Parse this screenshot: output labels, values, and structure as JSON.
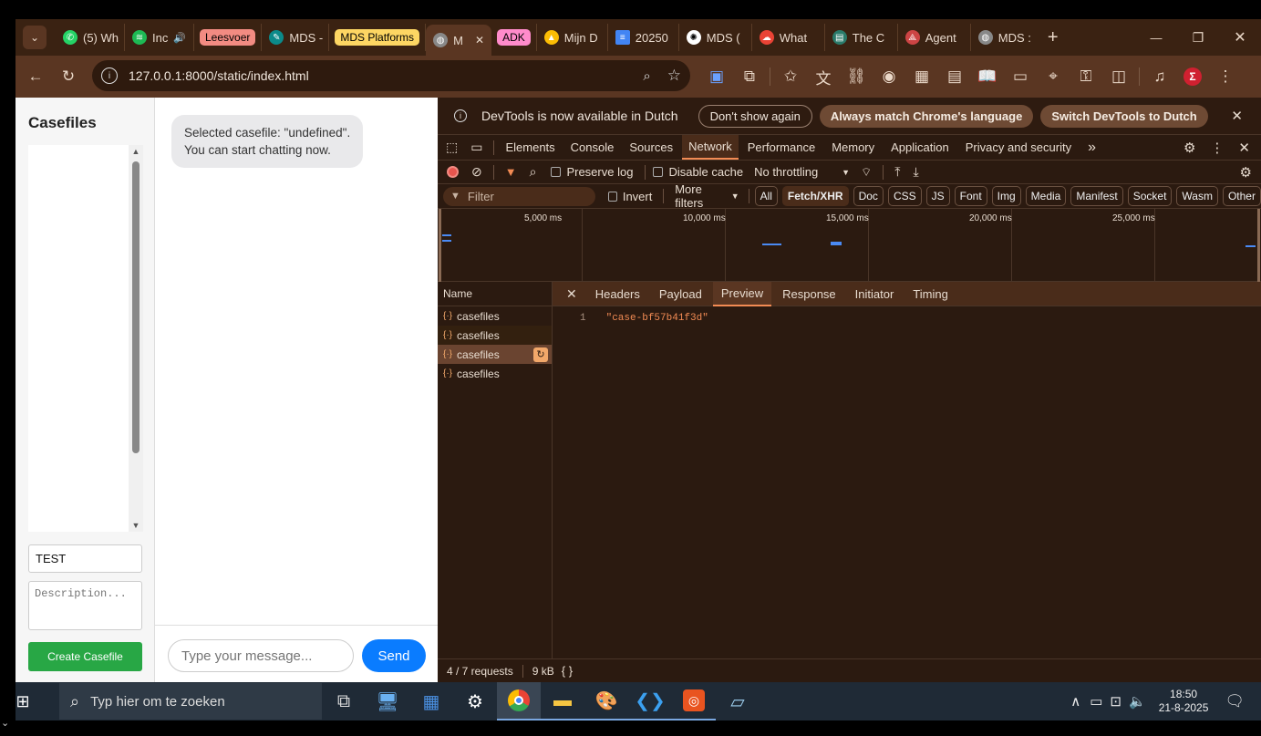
{
  "tabs": [
    {
      "title": "(5) Wh",
      "color": "#25d366",
      "icon": "whatsapp-icon"
    },
    {
      "title": "Inc",
      "color": "#1db954",
      "icon": "spotify-icon",
      "audio": "🔊"
    },
    {
      "group": "Leesvoer",
      "color": "#f28b82"
    },
    {
      "title": "MDS -",
      "color": "#1a73e8",
      "icon": "feather-icon"
    },
    {
      "group": "MDS Platforms",
      "color": "#fdd663"
    },
    {
      "title": "M",
      "active": true,
      "icon": "globe-icon",
      "close": "✕"
    },
    {
      "group": "ADK",
      "color": "#ff8bcb"
    },
    {
      "title": "Mijn D",
      "icon": "drive-icon"
    },
    {
      "title": "20250",
      "icon": "docs-icon"
    },
    {
      "title": "MDS (",
      "icon": "openai-icon"
    },
    {
      "title": "What",
      "icon": "cloud-icon"
    },
    {
      "title": "The C",
      "icon": "book-icon"
    },
    {
      "title": "Agent",
      "icon": "agent-icon"
    },
    {
      "title": "MDS :",
      "icon": "globe-icon"
    }
  ],
  "new_tab": "+",
  "window_controls": {
    "minimize": "—",
    "restore": "❐",
    "close": "✕"
  },
  "address": {
    "url": "127.0.0.1:8000/static/index.html"
  },
  "app": {
    "sidebar_title": "Casefiles",
    "name_value": "TEST",
    "description_placeholder": "Description...",
    "create_button": "Create Casefile",
    "bubble_line1": "Selected casefile: \"undefined\".",
    "bubble_line2": "You can start chatting now.",
    "message_placeholder": "Type your message...",
    "send_button": "Send"
  },
  "devtools": {
    "banner_text": "DevTools is now available in Dutch",
    "banner_btn1": "Don't show again",
    "banner_btn2": "Always match Chrome's language",
    "banner_btn3": "Switch DevTools to Dutch",
    "main_tabs": [
      "Elements",
      "Console",
      "Sources",
      "Network",
      "Performance",
      "Memory",
      "Application",
      "Privacy and security"
    ],
    "more_tabs": "»",
    "preserve_log": "Preserve log",
    "disable_cache": "Disable cache",
    "throttling": "No throttling",
    "filter_placeholder": "Filter",
    "invert": "Invert",
    "more_filters": "More filters",
    "type_filters": [
      "All",
      "Fetch/XHR",
      "Doc",
      "CSS",
      "JS",
      "Font",
      "Img",
      "Media",
      "Manifest",
      "Socket",
      "Wasm",
      "Other"
    ],
    "timeline_ticks": [
      "5,000 ms",
      "10,000 ms",
      "15,000 ms",
      "20,000 ms",
      "25,000 ms"
    ],
    "name_header": "Name",
    "requests": [
      "casefiles",
      "casefiles",
      "casefiles",
      "casefiles"
    ],
    "detail_tabs": [
      "Headers",
      "Payload",
      "Preview",
      "Response",
      "Initiator",
      "Timing"
    ],
    "preview_line_no": "1",
    "preview_value": "\"case-bf57b41f3d\"",
    "status_requests": "4 / 7 requests",
    "status_size": "9 kB",
    "status_braces": "{ }"
  },
  "taskbar": {
    "search_placeholder": "Typ hier om te zoeken",
    "time": "18:50",
    "date": "21-8-2025"
  }
}
